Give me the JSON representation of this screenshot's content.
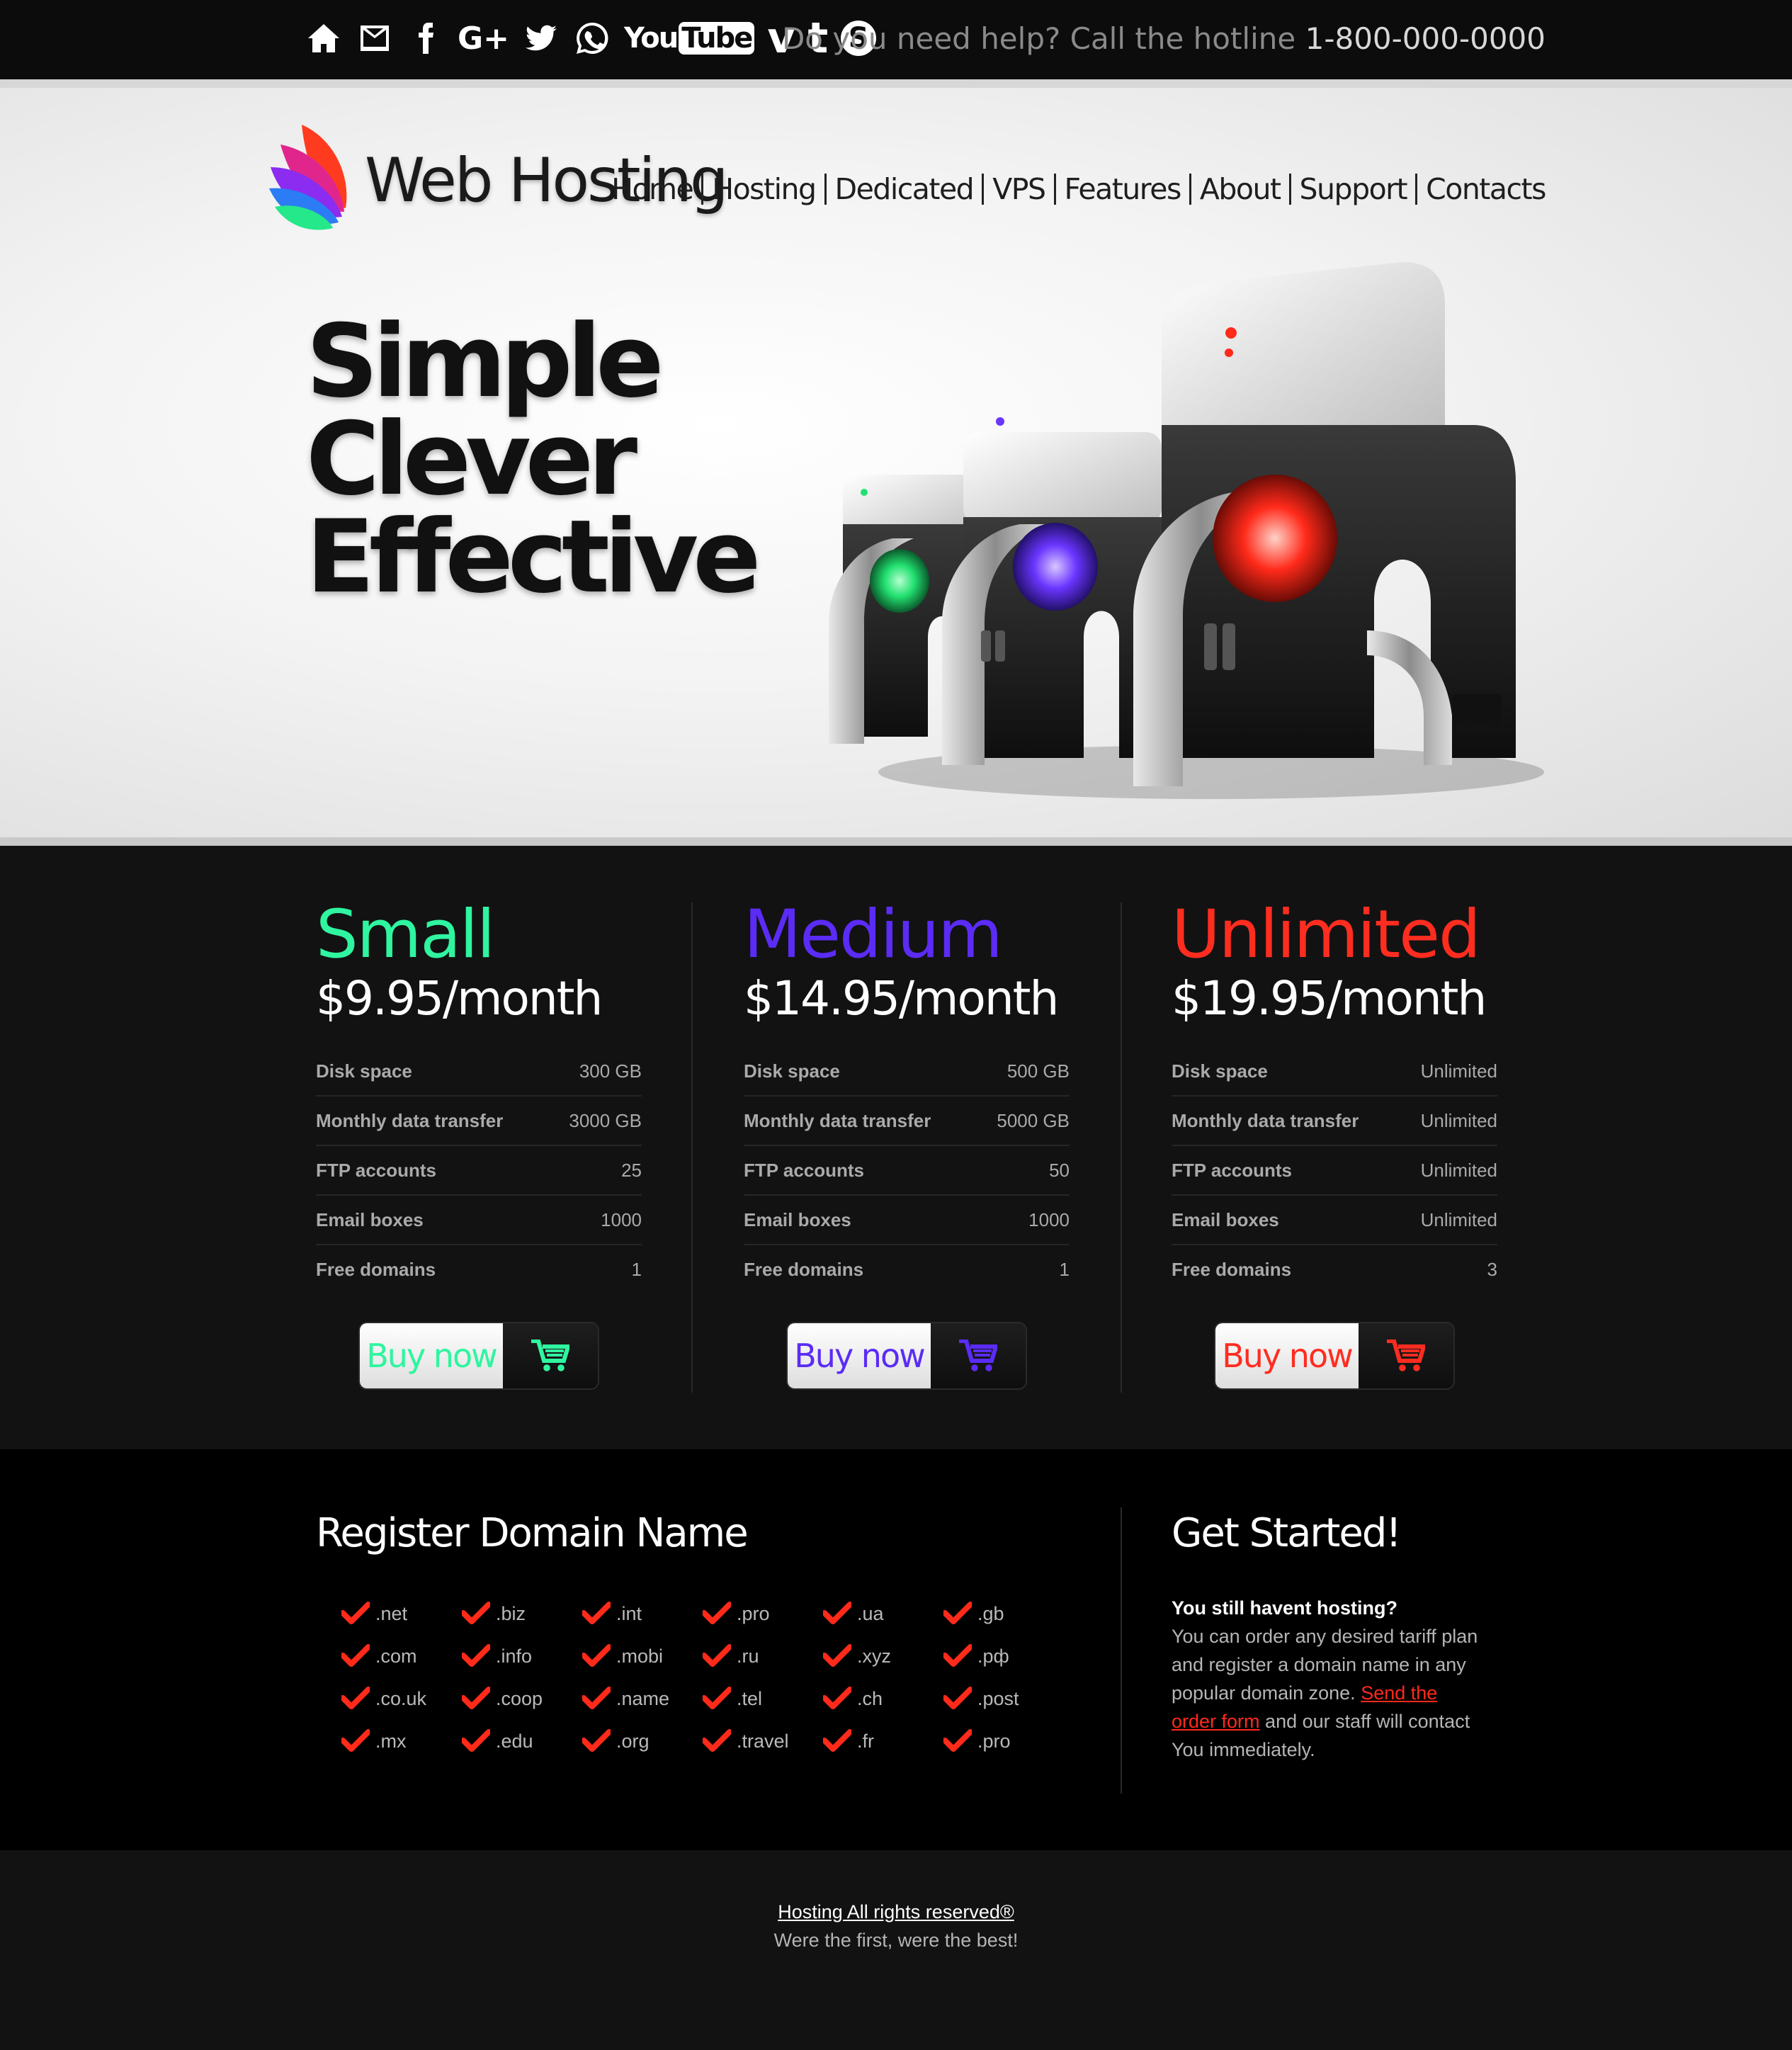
{
  "topbar": {
    "icons": [
      "home-icon",
      "mail-icon",
      "facebook-icon",
      "google-plus-icon",
      "twitter-icon",
      "whatsapp-icon",
      "youtube-icon",
      "vimeo-icon",
      "tumblr-icon",
      "skype-icon"
    ],
    "google_plus_text": "G+",
    "youtube_text_1": "You",
    "youtube_text_2": "Tube",
    "vimeo_text": "v",
    "tumblr_text": "t",
    "skype_text": "S",
    "hotline_prefix": "Do you need help? Call the hotline",
    "hotline_number": "1-800-000-0000"
  },
  "header": {
    "logo_text": "Web Hosting",
    "nav": [
      "Home",
      "Hosting",
      "Dedicated",
      "VPS",
      "Features",
      "About",
      "Support",
      "Contacts"
    ]
  },
  "hero": {
    "slogan": [
      "Simple",
      "Clever",
      "Effective"
    ]
  },
  "plans": [
    {
      "name": "Small",
      "price": "$9.95/month",
      "color": "#2ff5a0",
      "features": [
        [
          "Disk space",
          "300 GB"
        ],
        [
          "Monthly data transfer",
          "3000 GB"
        ],
        [
          "FTP accounts",
          "25"
        ],
        [
          "Email boxes",
          "1000"
        ],
        [
          "Free domains",
          "1"
        ]
      ],
      "buy_label": "Buy now"
    },
    {
      "name": "Medium",
      "price": "$14.95/month",
      "color": "#5a2cf5",
      "features": [
        [
          "Disk space",
          "500 GB"
        ],
        [
          "Monthly data transfer",
          "5000 GB"
        ],
        [
          "FTP accounts",
          "50"
        ],
        [
          "Email boxes",
          "1000"
        ],
        [
          "Free domains",
          "1"
        ]
      ],
      "buy_label": "Buy now"
    },
    {
      "name": "Unlimited",
      "price": "$19.95/month",
      "color": "#ff2d20",
      "features": [
        [
          "Disk space",
          "Unlimited"
        ],
        [
          "Monthly data transfer",
          "Unlimited"
        ],
        [
          "FTP accounts",
          "Unlimited"
        ],
        [
          "Email boxes",
          "Unlimited"
        ],
        [
          "Free domains",
          "3"
        ]
      ],
      "buy_label": "Buy now"
    }
  ],
  "domains": {
    "title": "Register Domain Name",
    "check_color": "#ff2a1a",
    "list": [
      ".net",
      ".biz",
      ".int",
      ".pro",
      ".ua",
      ".gb",
      ".com",
      ".info",
      ".mobi",
      ".ru",
      ".xyz",
      ".рф",
      ".co.uk",
      ".coop",
      ".name",
      ".tel",
      ".ch",
      ".post",
      ".mx",
      ".edu",
      ".org",
      ".travel",
      ".fr",
      ".pro"
    ]
  },
  "get_started": {
    "title": "Get Started!",
    "heading": "You still havent hosting?",
    "text_before": "You can order any desired tariff plan and register a domain name in any popular domain zone. ",
    "link": "Send the order form",
    "text_after": " and our staff will contact You immediately."
  },
  "footer": {
    "line1": "Hosting All rights reserved®",
    "line2": "Were the first, were the best!"
  }
}
